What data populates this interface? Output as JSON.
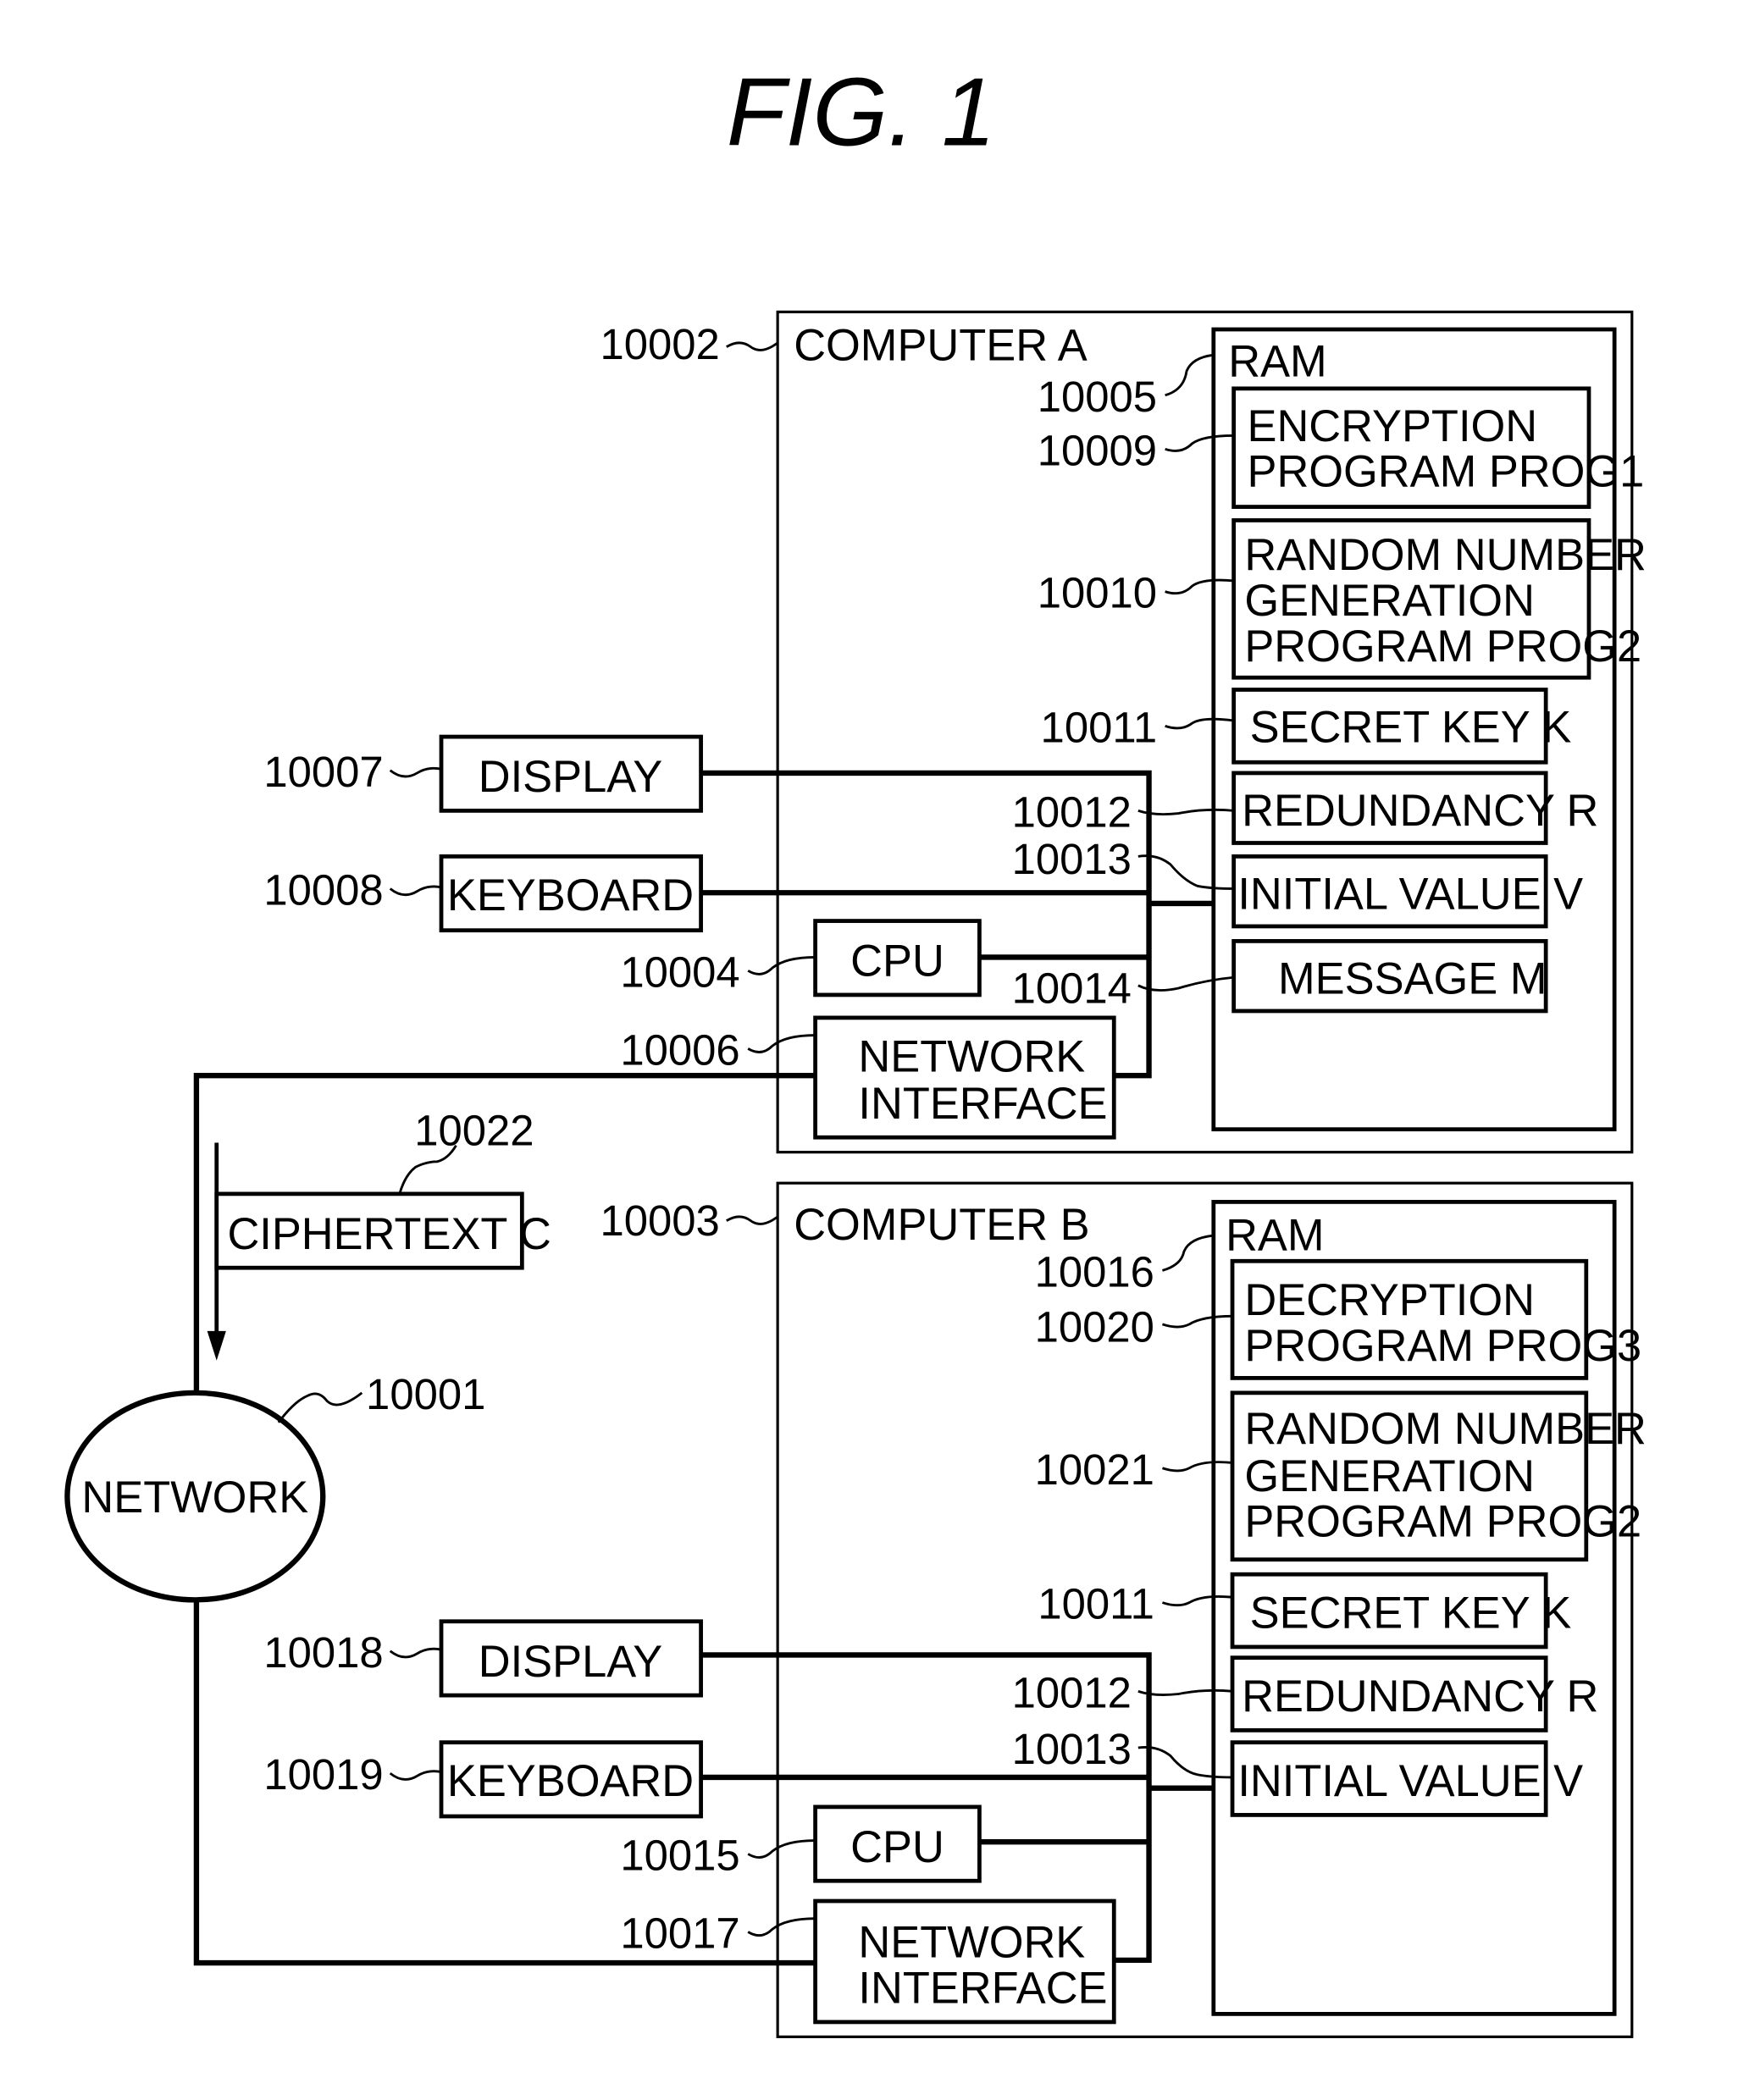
{
  "figure": {
    "title": "FIG.  1"
  },
  "network": {
    "label": "NETWORK",
    "ref": "10001"
  },
  "ciphertext": {
    "label": "CIPHERTEXT  C",
    "ref": "10022"
  },
  "computer_a": {
    "label": "COMPUTER  A",
    "ref": "10002",
    "ram": {
      "label": "RAM",
      "ref": "10005"
    },
    "ram_items": [
      {
        "ref": "10009",
        "lines": [
          "ENCRYPTION",
          "PROGRAM  PROG1"
        ]
      },
      {
        "ref": "10010",
        "lines": [
          "RANDOM  NUMBER",
          "GENERATION",
          "PROGRAM  PROG2"
        ]
      },
      {
        "ref": "10011",
        "lines": [
          "SECRET  KEY  K"
        ]
      },
      {
        "ref": "10012",
        "lines": [
          "REDUNDANCY  R"
        ]
      },
      {
        "ref": "10013",
        "lines": [
          "INITIAL  VALUE  V"
        ]
      },
      {
        "ref": "10014",
        "lines": [
          "MESSAGE  M"
        ]
      }
    ],
    "display": {
      "label": "DISPLAY",
      "ref": "10007"
    },
    "keyboard": {
      "label": "KEYBOARD",
      "ref": "10008"
    },
    "cpu": {
      "label": "CPU",
      "ref": "10004"
    },
    "network_interface": {
      "lines": [
        "NETWORK",
        "INTERFACE"
      ],
      "ref": "10006"
    }
  },
  "computer_b": {
    "label": "COMPUTER  B",
    "ref": "10003",
    "ram": {
      "label": "RAM",
      "ref": "10016"
    },
    "ram_items": [
      {
        "ref": "10020",
        "lines": [
          "DECRYPTION",
          "PROGRAM  PROG3"
        ]
      },
      {
        "ref": "10021",
        "lines": [
          "RANDOM  NUMBER",
          "GENERATION",
          "PROGRAM  PROG2"
        ]
      },
      {
        "ref": "10011",
        "lines": [
          "SECRET  KEY  K"
        ]
      },
      {
        "ref": "10012",
        "lines": [
          "REDUNDANCY  R"
        ]
      },
      {
        "ref": "10013",
        "lines": [
          "INITIAL  VALUE  V"
        ]
      }
    ],
    "display": {
      "label": "DISPLAY",
      "ref": "10018"
    },
    "keyboard": {
      "label": "KEYBOARD",
      "ref": "10019"
    },
    "cpu": {
      "label": "CPU",
      "ref": "10015"
    },
    "network_interface": {
      "lines": [
        "NETWORK",
        "INTERFACE"
      ],
      "ref": "10017"
    }
  }
}
